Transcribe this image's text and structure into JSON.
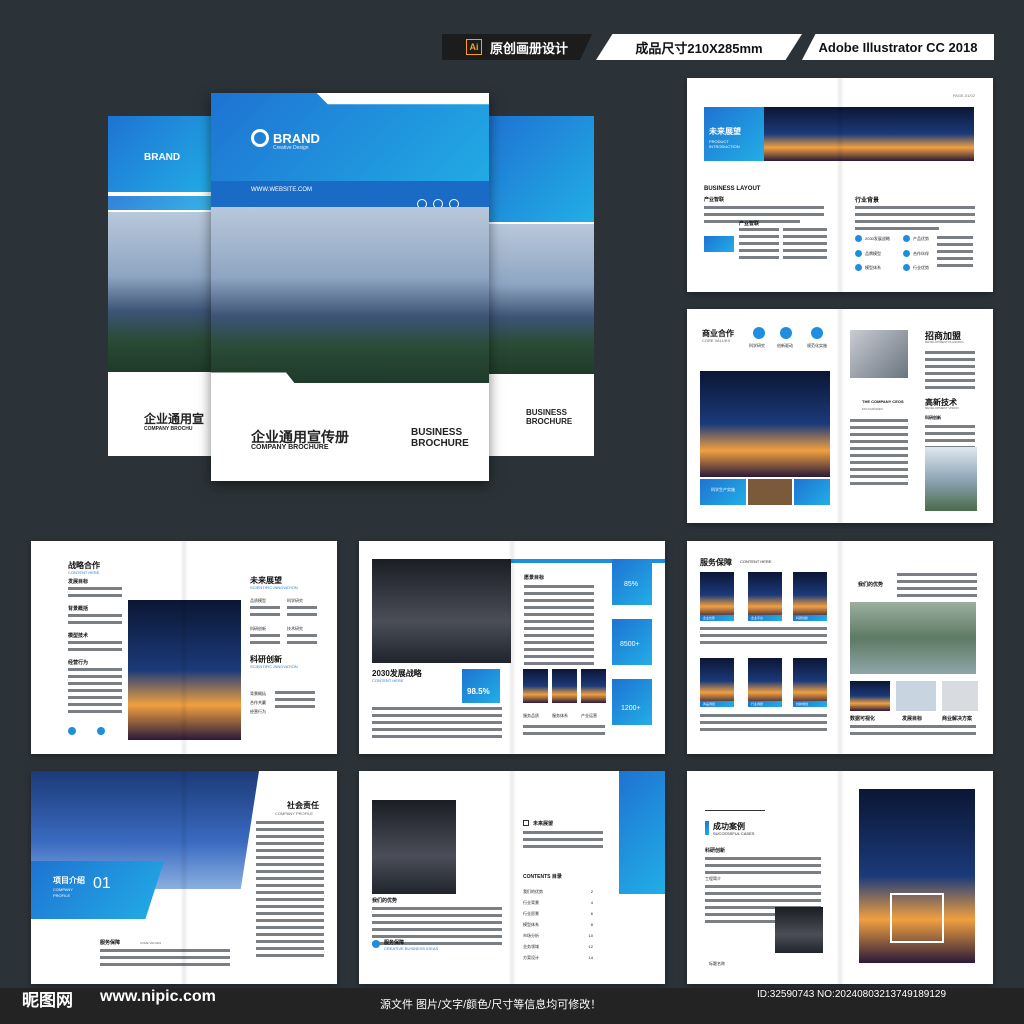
{
  "header": {
    "ai_label": "Ai",
    "badge_1": "原创画册设计",
    "badge_2": "成品尺寸210X285mm",
    "badge_3": "Adobe Illustrator CC 2018"
  },
  "cover": {
    "brand": "BRAND",
    "brand_sub": "Creative Design",
    "website": "WWW.WEBSITE.COM",
    "title_cn": "企业通用宣传册",
    "title_en": "COMPANY BROCHURE",
    "business": "BUSINESS",
    "brochure": "BROCHURE",
    "back_title_cn": "企业通用宣",
    "back_title_en": "COMPANY BROCHU"
  },
  "spread1": {
    "page_no": "PAGE-01/02",
    "title": "未来展望",
    "sub1": "PRODUCT",
    "sub2": "INTRODUCTION",
    "layout": "BUSINESS LAYOUT",
    "layout_cn": "产业智联",
    "item": "产业智联",
    "right_title": "行业背景",
    "icons": [
      "2030发展战略",
      "产品优势",
      "品牌模型",
      "合作伙伴",
      "模型体系",
      "行业优势"
    ]
  },
  "spread2": {
    "title": "商业合作",
    "sub": "CORE VALUES",
    "icons": [
      "科学研究",
      "创新驱动",
      "规范化实施"
    ],
    "right_title": "招商加盟",
    "right_sub": "DEVELOPMENT PLANNING",
    "ceos": "THE COMPANY CEOS",
    "ceos_sub": "FACCAROREN",
    "research": "科研创新",
    "tech": "高新技术",
    "tech_sub": "DEVELOPMENT VISION",
    "bar": "科学生产实施"
  },
  "spread3": {
    "title": "战略合作",
    "sub": "CONTENT HERE",
    "items": [
      "发展目标",
      "背景概括",
      "模型技术",
      "经营行为"
    ],
    "right_title": "未来展望",
    "right_sub": "SCIENTIFIC INNOVATION",
    "right_items": [
      "品质模型",
      "科学研究",
      "科研创新",
      "技术研究"
    ],
    "right_title2": "科研创新",
    "right_sub2": "SCIENTIFIC INNOVATION",
    "right_list": [
      "背景概括",
      "合作共赢",
      "经营行为"
    ]
  },
  "spread4": {
    "title": "2030发展战略",
    "sub": "CONTENT HERE",
    "goal": "愿景目标",
    "stat1": "85%",
    "stat2": "8500+",
    "stat3": "1200+",
    "stat_big": "98.5%",
    "captions": [
      "服务品质",
      "服务体系",
      "产业运营"
    ]
  },
  "spread5": {
    "title": "服务保障",
    "sub": "CONTENT HERE",
    "captions": [
      "企业优势",
      "企业平台",
      "科研创新",
      "商品调控",
      "行业调研",
      "创新规划"
    ],
    "right_title": "我们的优势",
    "bottom": [
      "数据可视化",
      "发展目标",
      "商业解决方案"
    ]
  },
  "spread6": {
    "title": "项目介绍",
    "sub1": "COMPANY",
    "sub2": "PROFILE",
    "num": "01",
    "right_title": "社会责任",
    "right_sub": "COMPANY PROFILE",
    "bottom": "服务保障",
    "bottom_sub": "CORE VALUES"
  },
  "spread7": {
    "advantage": "我们的优势",
    "service": "服务保障",
    "service_sub": "CREATIVE BUSINESS IDEAS",
    "future": "未来展望",
    "contents": "CONTENTS 目录",
    "toc": [
      [
        "我们的优势",
        "2"
      ],
      [
        "行业背景",
        "4"
      ],
      [
        "行业愿景",
        "6"
      ],
      [
        "模型体系",
        "8"
      ],
      [
        "市场分析",
        "10"
      ],
      [
        "业务领域",
        "12"
      ],
      [
        "方案设计",
        "14"
      ]
    ]
  },
  "spread8": {
    "title": "成功案例",
    "sub": "SUCCESSFUL CASES",
    "research": "科研创新",
    "engineering": "工程简介",
    "label": "标题名称"
  },
  "footer": {
    "logo_cn": "昵图网",
    "url": "www.nipic.com",
    "note": "源文件 图片/文字/颜色/尺寸等信息均可修改！",
    "id": "ID:32590743 NO:20240803213749189129"
  }
}
